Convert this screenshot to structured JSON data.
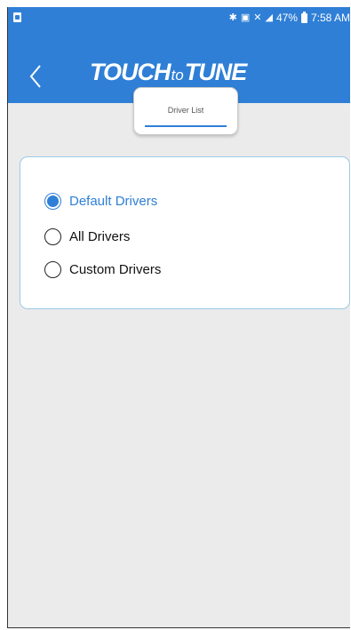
{
  "colors": {
    "brand_blue": "#2f7fd6",
    "background": "#ebebeb",
    "card_border": "#9ccbe8"
  },
  "status_bar": {
    "left_icon": "notification-icon",
    "icons": [
      "bluetooth-icon",
      "nfc-icon",
      "mute-icon",
      "signal-icon"
    ],
    "battery_percent": "47%",
    "time": "7:58 AM"
  },
  "header": {
    "back_icon": "chevron-left-icon",
    "logo": {
      "part1": "TOUCH",
      "part2": "to",
      "part3": "TUNE"
    }
  },
  "tab": {
    "label": "Driver List"
  },
  "radio_group": {
    "options": [
      {
        "label": "Default Drivers",
        "selected": true
      },
      {
        "label": "All Drivers",
        "selected": false
      },
      {
        "label": "Custom Drivers",
        "selected": false
      }
    ]
  }
}
